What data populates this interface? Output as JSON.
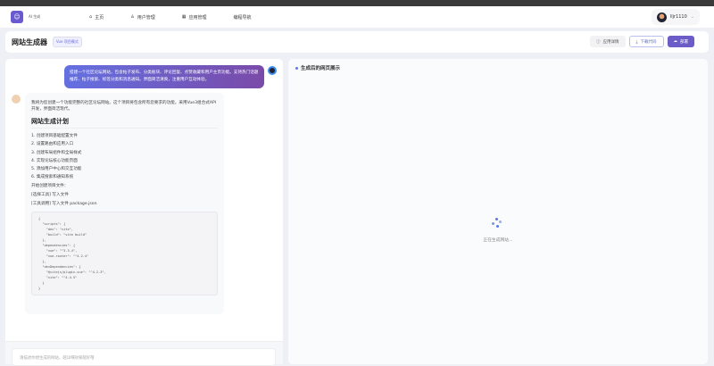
{
  "nav": {
    "brand": "AI 生成",
    "items": [
      {
        "label": "主页",
        "icon": "home-icon"
      },
      {
        "label": "用户管理",
        "icon": "user-icon"
      },
      {
        "label": "应用管理",
        "icon": "grid-icon"
      },
      {
        "label": "编程导航",
        "icon": ""
      }
    ],
    "username": "lljr1110"
  },
  "header": {
    "title": "网站生成器",
    "badge": "Vue 项目模式",
    "actions": {
      "details": "应用详情",
      "download": "下载代码",
      "deploy": "部署"
    }
  },
  "chat": {
    "user_message": "搭建一个社区论坛网站，包含帖子发布、分类板块、评论回复、点赞收藏和用户主页功能。支持热门话题推荐、帖子搜索、标签分类和消息通知。界面简洁清爽，注重用户互动体验。",
    "ai_intro": "我将为您创建一个功能完整的社区论坛网站。这个项目将包含所有您要求的功能，采用Vue3组合式API开发，界面简洁现代。",
    "plan_title": "网站生成计划",
    "plan": [
      "1. 创建项目基础配置文件",
      "2. 设置路由和应用入口",
      "3. 创建布局组件和全局样式",
      "4. 实现论坛核心功能页面",
      "5. 添加用户中心和交互功能",
      "6. 集成搜索和通知系统"
    ],
    "start": "开始创建项目文件：",
    "tool_select": "[选择工具] 写入文件",
    "tool_call": "[工具调用] 写入文件 package.json",
    "code": "{\n  \"scripts\": {\n    \"dev\": \"vite\",\n    \"build\": \"vite build\"\n  },\n  \"dependencies\": {\n    \"vue\": \"^3.3.4\",\n    \"vue-router\": \"^4.2.4\"\n  },\n  \"devDependencies\": {\n    \"@vitejs/plugin-vue\": \"^4.2.3\",\n    \"vite\": \"^4.4.5\"\n  }\n}",
    "input_placeholder": "请描述你想生成的网站，越详细效果越好哦"
  },
  "preview": {
    "title": "生成后的网页展示",
    "loading": "正在生成网站..."
  }
}
